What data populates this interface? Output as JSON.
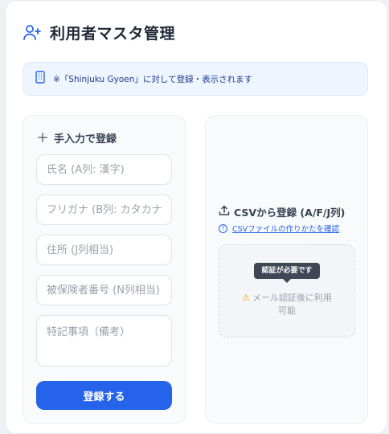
{
  "header": {
    "title": "利用者マスタ管理",
    "icon": "user-plus-icon"
  },
  "notice": {
    "text": "※「Shinjuku Gyoen」に対して登録・表示されます",
    "icon": "building-icon"
  },
  "manual": {
    "heading": "手入力で登録",
    "icon": "plus-icon",
    "fields": {
      "name": "氏名 (A列: 漢字)",
      "kana": "フリガナ (B列: カタカナ)",
      "address": "住所 (J列相当)",
      "insured_no": "被保険者番号 (N列相当)",
      "remarks": "特記事項（備考）"
    },
    "submit_label": "登録する"
  },
  "csv": {
    "heading": "CSVから登録 (A/F/J列)",
    "icon": "upload-icon",
    "help_link": "CSVファイルの作りかたを確認",
    "tooltip": "認証が必要です",
    "drop_line1": "メール認証後に利用",
    "drop_line2": "可能",
    "warning_icon": "warning-icon"
  },
  "colors": {
    "primary": "#2563eb",
    "notice_bg": "#eef5fe",
    "panel_bg": "#f8fafc"
  }
}
